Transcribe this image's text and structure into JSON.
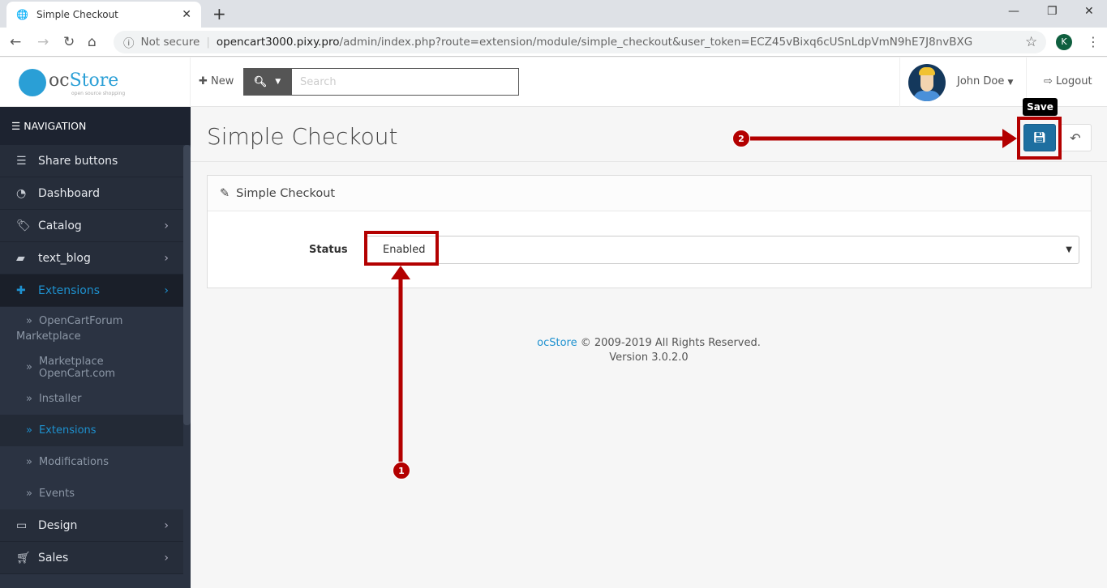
{
  "browser": {
    "tab_title": "Simple Checkout",
    "security": "Not secure",
    "url_host": "opencart3000.pixy.pro",
    "url_path": "/admin/index.php?route=extension/module/simple_checkout&user_token=ECZ45vBixq6cUSnLdpVmN9hE7J8nvBXG",
    "profile_initial": "K"
  },
  "header": {
    "logo": "ocStore",
    "logo_tagline": "open source shopping",
    "new_label": "New",
    "search_placeholder": "Search",
    "user_name": "John Doe",
    "logout_label": "Logout"
  },
  "sidebar": {
    "heading": "NAVIGATION",
    "items": [
      {
        "label": "Share buttons"
      },
      {
        "label": "Dashboard"
      },
      {
        "label": "Catalog"
      },
      {
        "label": "text_blog"
      },
      {
        "label": "Extensions"
      }
    ],
    "sub": [
      {
        "label": "OpenCartForum Marketplace"
      },
      {
        "label": "Marketplace OpenCart.com"
      },
      {
        "label": "Installer"
      },
      {
        "label": "Extensions"
      },
      {
        "label": "Modifications"
      },
      {
        "label": "Events"
      }
    ],
    "items2": [
      {
        "label": "Design"
      },
      {
        "label": "Sales"
      }
    ]
  },
  "page": {
    "title": "Simple Checkout",
    "save_tooltip": "Save",
    "panel_title": "Simple Checkout",
    "status_label": "Status",
    "status_value": "Enabled"
  },
  "footer": {
    "brand": "ocStore",
    "copyright": " © 2009-2019 All Rights Reserved.",
    "version": "Version 3.0.2.0"
  },
  "annotations": {
    "step1": "1",
    "step2": "2",
    "color": "#b30000"
  }
}
